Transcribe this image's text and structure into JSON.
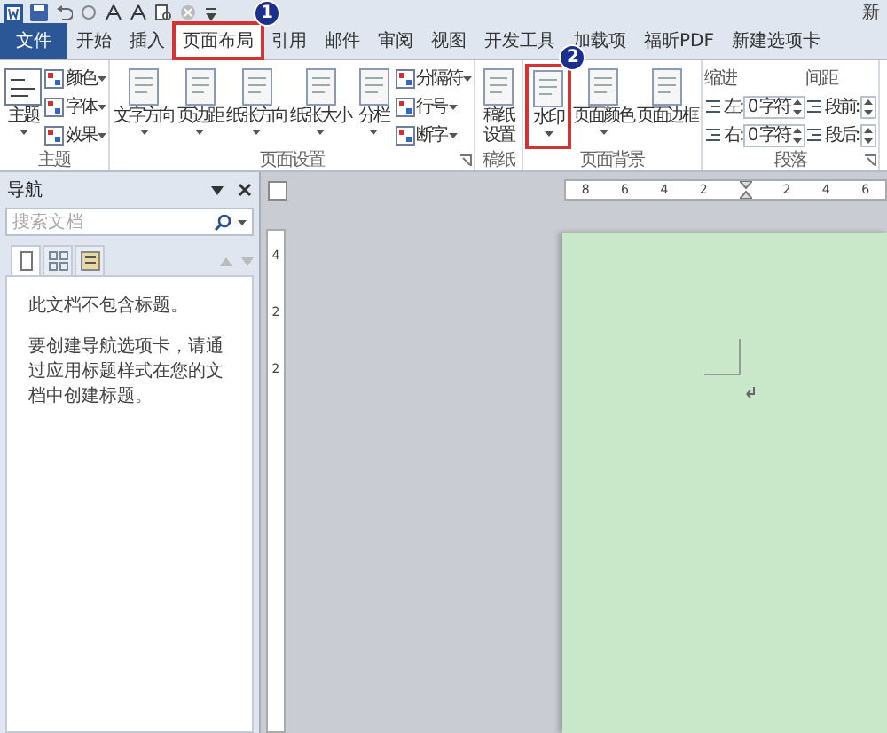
{
  "title_fragment": "新",
  "tabs": [
    {
      "label": "文件",
      "kind": "file",
      "selected": false,
      "highlighted": false
    },
    {
      "label": "开始",
      "kind": "tab",
      "selected": false,
      "highlighted": false
    },
    {
      "label": "插入",
      "kind": "tab",
      "selected": false,
      "highlighted": false
    },
    {
      "label": "页面布局",
      "kind": "tab",
      "selected": true,
      "highlighted": true,
      "callout": "1"
    },
    {
      "label": "引用",
      "kind": "tab",
      "selected": false,
      "highlighted": false
    },
    {
      "label": "邮件",
      "kind": "tab",
      "selected": false,
      "highlighted": false
    },
    {
      "label": "审阅",
      "kind": "tab",
      "selected": false,
      "highlighted": false
    },
    {
      "label": "视图",
      "kind": "tab",
      "selected": false,
      "highlighted": false
    },
    {
      "label": "开发工具",
      "kind": "tab",
      "selected": false,
      "highlighted": false
    },
    {
      "label": "加载项",
      "kind": "tab",
      "selected": false,
      "highlighted": false
    },
    {
      "label": "福昕PDF",
      "kind": "tab",
      "selected": false,
      "highlighted": false
    },
    {
      "label": "新建选项卡",
      "kind": "tab",
      "selected": false,
      "highlighted": false
    }
  ],
  "ribbon_groups": [
    {
      "title": "主题",
      "launcher": false,
      "items": [
        {
          "kind": "large",
          "label": "主题",
          "dropdown": true,
          "highlighted": false
        },
        {
          "kind": "column",
          "items": [
            {
              "kind": "small",
              "label": "颜色",
              "dropdown": true
            },
            {
              "kind": "small",
              "label": "字体",
              "dropdown": true
            },
            {
              "kind": "small",
              "label": "效果",
              "dropdown": true
            }
          ]
        }
      ]
    },
    {
      "title": "页面设置",
      "launcher": true,
      "items": [
        {
          "kind": "large",
          "label": "文字方向",
          "dropdown": true,
          "highlighted": false
        },
        {
          "kind": "large",
          "label": "页边距",
          "dropdown": true,
          "highlighted": false
        },
        {
          "kind": "large",
          "label": "纸张方向",
          "dropdown": true,
          "highlighted": false
        },
        {
          "kind": "large",
          "label": "纸张大小",
          "dropdown": true,
          "highlighted": false
        },
        {
          "kind": "large",
          "label": "分栏",
          "dropdown": true,
          "highlighted": false
        },
        {
          "kind": "column",
          "items": [
            {
              "kind": "small",
              "label": "分隔符",
              "dropdown": true
            },
            {
              "kind": "small",
              "label": "行号",
              "dropdown": true
            },
            {
              "kind": "small",
              "label": "断字",
              "dropdown": true
            }
          ]
        }
      ]
    },
    {
      "title": "稿纸",
      "launcher": false,
      "items": [
        {
          "kind": "large",
          "lines": [
            "稿纸",
            "设置"
          ],
          "dropdown": false,
          "highlighted": false
        }
      ]
    },
    {
      "title": "页面背景",
      "launcher": false,
      "items": [
        {
          "kind": "large",
          "label": "水印",
          "dropdown": true,
          "highlighted": true,
          "callout": "2"
        },
        {
          "kind": "large",
          "label": "页面颜色",
          "dropdown": true,
          "highlighted": false
        },
        {
          "kind": "large",
          "label": "页面边框",
          "dropdown": false,
          "highlighted": false
        }
      ]
    },
    {
      "title": "段落",
      "launcher": true,
      "items": [
        {
          "kind": "column",
          "heading": "缩进",
          "items": [
            {
              "kind": "spin",
              "label": "左:",
              "value": "0 字符"
            },
            {
              "kind": "spin",
              "label": "右:",
              "value": "0 字符"
            }
          ]
        },
        {
          "kind": "column",
          "heading": "间距",
          "items": [
            {
              "kind": "spin",
              "label": "段前:"
            },
            {
              "kind": "spin",
              "label": "段后:"
            }
          ]
        }
      ]
    }
  ],
  "nav_pane": {
    "title": "导航",
    "search": {
      "placeholder": "搜索文档"
    },
    "view_tabs": [
      {
        "selected": true
      },
      {
        "selected": false
      },
      {
        "selected": false
      }
    ],
    "message": "此文档不包含标题。",
    "hint": "要创建导航选项卡，请通过应用标题样式在您的文档中创建标题。"
  },
  "ruler": {
    "labels": [
      "8",
      "6",
      "4",
      "2",
      "2",
      "4",
      "6"
    ]
  },
  "vertical_ruler": {
    "labels": [
      "4",
      "2",
      "2"
    ]
  }
}
